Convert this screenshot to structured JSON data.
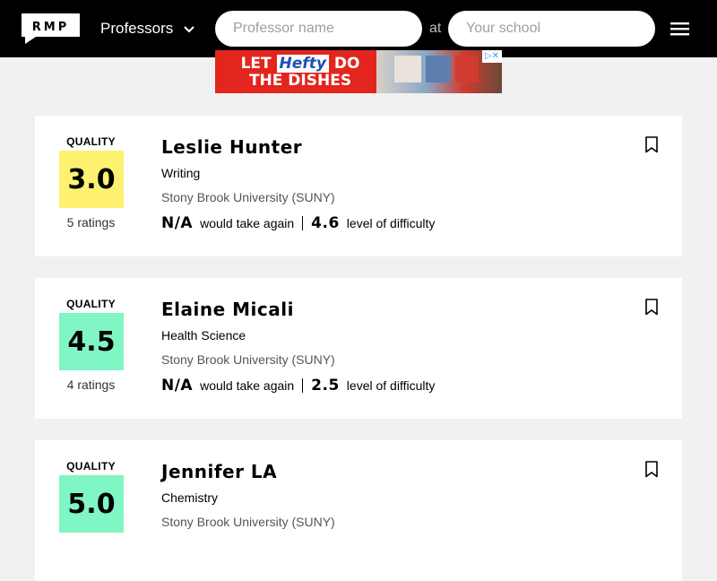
{
  "header": {
    "logo_text": "RMP",
    "professors_dropdown": "Professors",
    "professor_placeholder": "Professor name",
    "at_text": "at",
    "school_placeholder": "Your school"
  },
  "ad": {
    "line1_pre": "LET ",
    "brand": "Hefty",
    "line1_post": " DO",
    "line2": "THE DISHES"
  },
  "professors": [
    {
      "quality_label": "QUALITY",
      "rating": "3.0",
      "rating_color": "#fff170",
      "ratings_count": "5 ratings",
      "name": "Leslie Hunter",
      "department": "Writing",
      "school": "Stony Brook University (SUNY)",
      "would_take_again": "N/A",
      "would_take_again_label": "would take again",
      "difficulty": "4.6",
      "difficulty_label": "level of difficulty"
    },
    {
      "quality_label": "QUALITY",
      "rating": "4.5",
      "rating_color": "#7ff6c3",
      "ratings_count": "4 ratings",
      "name": "Elaine Micali",
      "department": "Health Science",
      "school": "Stony Brook University (SUNY)",
      "would_take_again": "N/A",
      "would_take_again_label": "would take again",
      "difficulty": "2.5",
      "difficulty_label": "level of difficulty"
    },
    {
      "quality_label": "QUALITY",
      "rating": "5.0",
      "rating_color": "#7ff6c3",
      "ratings_count": "",
      "name": "Jennifer LA",
      "department": "Chemistry",
      "school": "Stony Brook University (SUNY)",
      "would_take_again": "",
      "would_take_again_label": "",
      "difficulty": "",
      "difficulty_label": ""
    }
  ]
}
